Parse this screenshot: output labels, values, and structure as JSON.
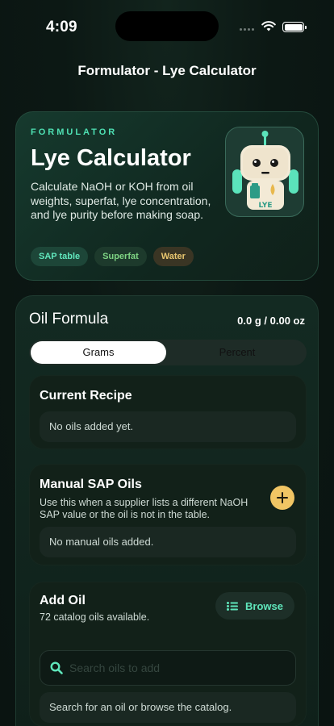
{
  "status_bar": {
    "time": "4:09"
  },
  "nav": {
    "title": "Formulator - Lye Calculator"
  },
  "hero": {
    "eyebrow": "FORMULATOR",
    "title": "Lye Calculator",
    "description": "Calculate NaOH or KOH from oil weights, superfat, lye concentration, and lye purity before making soap.",
    "chips": [
      "SAP table",
      "Superfat",
      "Water"
    ],
    "mascot_label": "LYE",
    "colors": {
      "accent": "#4ee0b3",
      "chip_superfat": "#7ed483",
      "chip_water": "#e7c56f"
    }
  },
  "oil_formula": {
    "title": "Oil Formula",
    "total": "0.0 g / 0.00 oz",
    "segments": {
      "options": [
        "Grams",
        "Percent"
      ],
      "selected": "Grams"
    },
    "current_recipe": {
      "title": "Current Recipe",
      "empty_text": "No oils added yet."
    },
    "manual_sap": {
      "title": "Manual SAP Oils",
      "description": "Use this when a supplier lists a different NaOH SAP value or the oil is not in the table.",
      "empty_text": "No manual oils added.",
      "add_icon": "plus-icon"
    },
    "add_oil": {
      "title": "Add Oil",
      "subtitle": "72 catalog oils available.",
      "browse_label": "Browse",
      "search_placeholder": "Search oils to add",
      "hint": "Search for an oil or browse the catalog."
    }
  }
}
